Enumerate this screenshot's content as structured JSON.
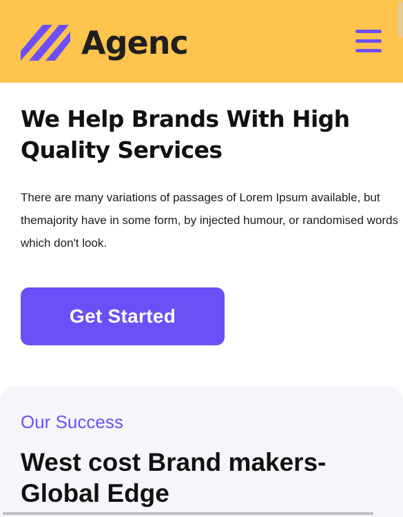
{
  "header": {
    "logo_text": "Agenc",
    "logo_icon": "slanted-stripes-logo-icon",
    "menu_icon": "hamburger-menu-icon",
    "background_color": "#ffc44d",
    "accent_color": "#6c4ff6"
  },
  "hero": {
    "title": "We Help Brands With High Quality Services",
    "description": "There are many variations of passages of Lorem Ipsum available, but themajority have in some form, by injected humour, or randomised words which don't look.",
    "cta_label": "Get Started"
  },
  "success": {
    "eyebrow": "Our Success",
    "title": "West cost Brand makers-Global Edge"
  }
}
